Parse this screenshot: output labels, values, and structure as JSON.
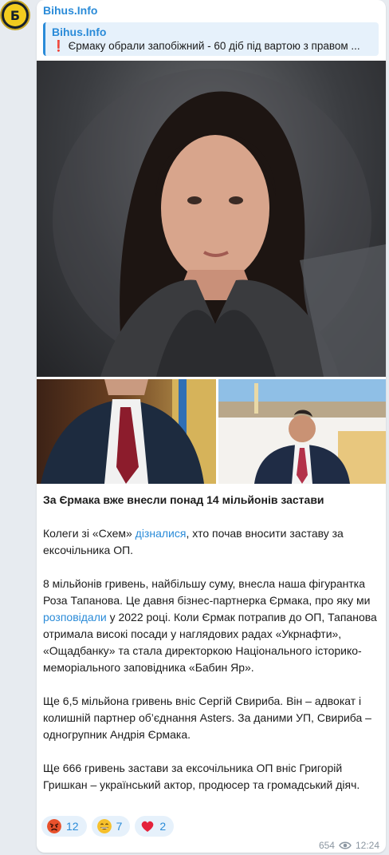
{
  "channel": {
    "name": "Bihus.Info",
    "avatar_glyph": "Б",
    "avatar_color": "#f2cc1f",
    "accent_color": "#2a8bd8"
  },
  "reply": {
    "title": "Bihus.Info",
    "emoji": "❗",
    "text": "Єрмаку обрали запобіжний - 60 діб під вартою з правом ..."
  },
  "post": {
    "title": "За Єрмака вже внесли понад 14 мільйонів застави",
    "p1_before": "Колеги зі «Схем» ",
    "p1_link": "дізналися",
    "p1_after": ", хто почав вносити заставу за ексочільника ОП.",
    "p2_before": "8 мільйонів гривень, найбільшу суму, внесла наша фігурантка Роза Тапанова. Це давня бізнес-партнерка Єрмака, про яку ми ",
    "p2_link": "розповідали",
    "p2_after": " у 2022 році. Коли Єрмак потрапив до ОП, Тапанова отримала високі посади у наглядових радах «Укрнафти», «Ощадбанку» та стала директоркою Національного історико-меморіального заповідника «Бабин Яр».",
    "p3": "Ще 6,5 мільйона гривень вніс Сергій Свириба. Він – адвокат і колишній партнер об’єднання Asters. За даними УП, Свириба – одногрупник Андрія Єрмака.",
    "p4": "Ще 666 гривень застави за ексочільника ОП вніс Григорій Гришкан – український актор, продюсер та громадський діяч."
  },
  "reactions": [
    {
      "icon": "angry-face-icon",
      "count": "12"
    },
    {
      "icon": "grinning-face-icon",
      "count": "7"
    },
    {
      "icon": "red-heart-icon",
      "count": "2"
    }
  ],
  "meta": {
    "views": "654",
    "time": "12:24"
  }
}
